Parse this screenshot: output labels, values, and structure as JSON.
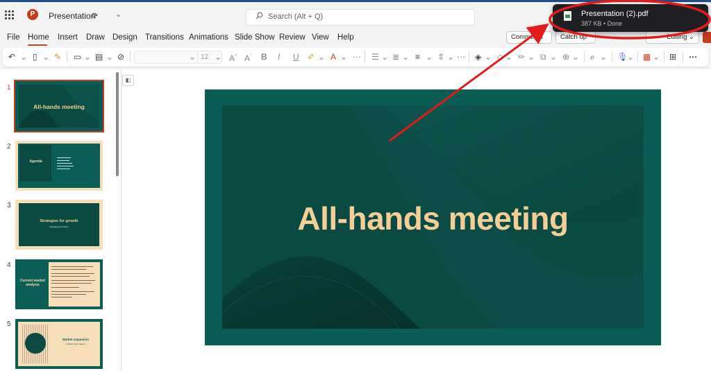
{
  "app": {
    "doc_title": "Presentation"
  },
  "search": {
    "placeholder": "Search (Alt + Q)"
  },
  "menu": {
    "items": [
      "File",
      "Home",
      "Insert",
      "Draw",
      "Design",
      "Transitions",
      "Animations",
      "Slide Show",
      "Review",
      "View",
      "Help"
    ],
    "active": "Home"
  },
  "header_buttons": {
    "comments": "Comments",
    "catch_up": "Catch up",
    "editing": "Editing"
  },
  "ribbon": {
    "font_size": "12"
  },
  "slides": [
    {
      "number": "1",
      "title": "All-hands meeting"
    },
    {
      "number": "2",
      "title": "Agenda"
    },
    {
      "number": "3",
      "title": "Strategies for growth",
      "subtitle": "Navigating the future"
    },
    {
      "number": "4",
      "title": "Current market analysis"
    },
    {
      "number": "5",
      "title": "Market expansion",
      "subtitle": "Untitled new markets"
    }
  ],
  "current_slide": {
    "title": "All-hands meeting"
  },
  "download": {
    "file_name": "Presentation (2).pdf",
    "meta": "387 KB • Done"
  },
  "colors": {
    "accent": "#c43e1c",
    "slide_teal": "#0b4a43",
    "slide_border": "#0a5d54",
    "title_gold": "#f4cf95",
    "annotation_red": "#e21b1b"
  }
}
